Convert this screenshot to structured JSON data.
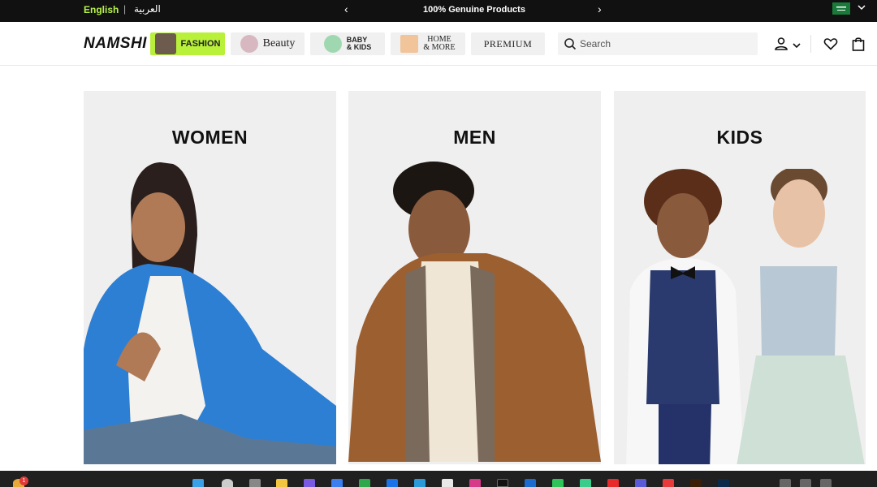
{
  "topbar": {
    "lang_english": "English",
    "lang_separator": "|",
    "lang_arabic": "العربية",
    "promo_text": "100% Genuine Products",
    "prev_arrow": "‹",
    "next_arrow": "›",
    "flag_icon": "saudi-flag-icon",
    "country_chevron": "⌄"
  },
  "header": {
    "logo": "NAMSHI",
    "categories": [
      {
        "label": "FASHION",
        "thumb_icon": "fashion-models-thumb",
        "active": true
      },
      {
        "label": "Beauty",
        "thumb_icon": "beauty-model-thumb"
      },
      {
        "label": "BABY\n& KIDS",
        "thumb_icon": "baby-kids-thumb"
      },
      {
        "label": "HOME\n& MORE",
        "thumb_icon": "home-lamp-thumb"
      },
      {
        "label": "PREMIUM"
      }
    ],
    "search": {
      "placeholder": "Search",
      "icon": "search-icon"
    },
    "icons": [
      "user-icon",
      "chevron-down-icon",
      "heart-icon",
      "shopping-bag-icon"
    ]
  },
  "main": {
    "cards": [
      {
        "title": "WOMEN",
        "image": "woman-blue-blazer-photo"
      },
      {
        "title": "MEN",
        "image": "man-brown-jacket-photo"
      },
      {
        "title": "KIDS",
        "image": "kids-formal-wear-photo"
      }
    ]
  },
  "taskbar": {
    "notification_badge": "1"
  },
  "colors": {
    "topbar_bg": "#111111",
    "accent_green": "#b8f03a",
    "card_bg": "#efefef"
  }
}
